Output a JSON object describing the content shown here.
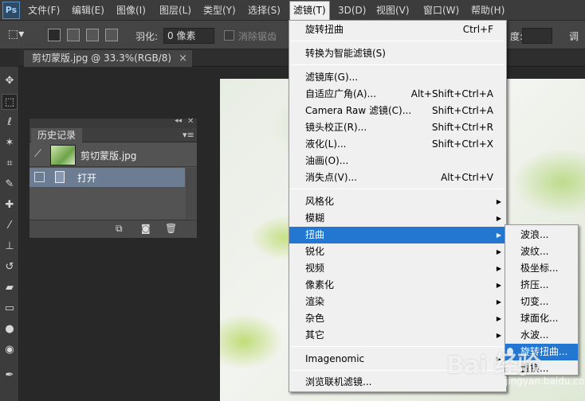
{
  "app": {
    "logo": "Ps"
  },
  "menubar": {
    "items": [
      "文件(F)",
      "编辑(E)",
      "图像(I)",
      "图层(L)",
      "类型(Y)",
      "选择(S)",
      "滤镜(T)",
      "3D(D)",
      "视图(V)",
      "窗口(W)",
      "帮助(H)"
    ],
    "active": "滤镜(T)"
  },
  "options": {
    "feather_label": "羽化:",
    "feather_value": "0 像素",
    "antialias_label": "消除锯齿",
    "right_label": "度:",
    "right_button": "调"
  },
  "document": {
    "tab_title": "剪切蒙版.jpg @ 33.3%(RGB/8)",
    "close": "×"
  },
  "history": {
    "tab": "历史记录",
    "collapse": "◂◂",
    "close": "✕",
    "menu": "▾≡",
    "snapshot_name": "剪切蒙版.jpg",
    "step_name": "打开"
  },
  "filter_menu": {
    "items": [
      {
        "label": "旋转扭曲",
        "shortcut": "Ctrl+F"
      },
      {
        "label": "转换为智能滤镜(S)",
        "shortcut": ""
      },
      {
        "label": "滤镜库(G)...",
        "shortcut": ""
      },
      {
        "label": "自适应广角(A)...",
        "shortcut": "Alt+Shift+Ctrl+A"
      },
      {
        "label": "Camera Raw 滤镜(C)...",
        "shortcut": "Shift+Ctrl+A"
      },
      {
        "label": "镜头校正(R)...",
        "shortcut": "Shift+Ctrl+R"
      },
      {
        "label": "液化(L)...",
        "shortcut": "Shift+Ctrl+X"
      },
      {
        "label": "油画(O)...",
        "shortcut": ""
      },
      {
        "label": "消失点(V)...",
        "shortcut": "Alt+Ctrl+V"
      },
      {
        "label": "风格化",
        "shortcut": ""
      },
      {
        "label": "模糊",
        "shortcut": ""
      },
      {
        "label": "扭曲",
        "shortcut": ""
      },
      {
        "label": "锐化",
        "shortcut": ""
      },
      {
        "label": "视频",
        "shortcut": ""
      },
      {
        "label": "像素化",
        "shortcut": ""
      },
      {
        "label": "渲染",
        "shortcut": ""
      },
      {
        "label": "杂色",
        "shortcut": ""
      },
      {
        "label": "其它",
        "shortcut": ""
      },
      {
        "label": "Imagenomic",
        "shortcut": ""
      },
      {
        "label": "浏览联机滤镜...",
        "shortcut": ""
      }
    ],
    "arrow": "▶"
  },
  "distort_submenu": {
    "items": [
      "波浪...",
      "波纹...",
      "极坐标...",
      "挤压...",
      "切变...",
      "球面化...",
      "水波...",
      "旋转扭曲...",
      "置换..."
    ],
    "highlighted": "旋转扭曲..."
  },
  "watermark": {
    "logo": "Bai 经验",
    "sub": "jingyan.baidu.com"
  },
  "icons": {
    "toolbar": [
      "move-icon",
      "marquee-icon",
      "lasso-icon",
      "magic-wand-icon",
      "crop-icon",
      "eyedropper-icon",
      "healing-brush-icon",
      "brush-icon",
      "stamp-icon",
      "history-brush-icon",
      "eraser-icon",
      "gradient-icon",
      "blur-icon",
      "dodge-icon",
      "pen-icon"
    ]
  },
  "colors": {
    "highlight": "#2377d1",
    "menu_bg": "#f0f0f0",
    "ui_dark": "#3c3c3c"
  }
}
